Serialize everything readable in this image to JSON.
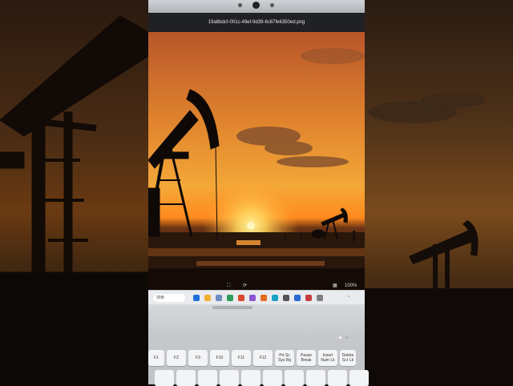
{
  "viewer": {
    "filename": "19a8bdcf-001c-49ef-9d39-6c67fe6350ed.png",
    "zoom": "100%"
  },
  "taskbar": {
    "search_label": "搜索",
    "icons": [
      "#1e6fd9",
      "#f2b134",
      "#6c8ebf",
      "#2c9e5a",
      "#d9472b",
      "#8a57d1",
      "#e36b1e",
      "#1aa3c7",
      "#555",
      "#2b6cd3",
      "#c93c3c",
      "#7f7f7f"
    ]
  },
  "keyboard": {
    "row1": [
      {
        "name": "f-key-esc",
        "label": "F1"
      },
      {
        "name": "f-key-2",
        "label": "F2"
      },
      {
        "name": "f-key-3",
        "label": "F3"
      },
      {
        "name": "f-key-10",
        "label": "F10"
      },
      {
        "name": "f-key-11",
        "label": "F11"
      },
      {
        "name": "f-key-12",
        "label": "F12"
      },
      {
        "name": "key-prtsc",
        "label": "Prt Sc\nSys Rq"
      },
      {
        "name": "key-pause",
        "label": "Pause\nBreak"
      },
      {
        "name": "key-insert",
        "label": "Insert\nNum Lk"
      },
      {
        "name": "key-delete",
        "label": "Delete\nScr Lk"
      }
    ]
  },
  "colors": {
    "sky_top": "#c9632a",
    "sky_mid": "#e8912f",
    "sun": "#ffd35a",
    "horizon": "#ff8a1e"
  }
}
